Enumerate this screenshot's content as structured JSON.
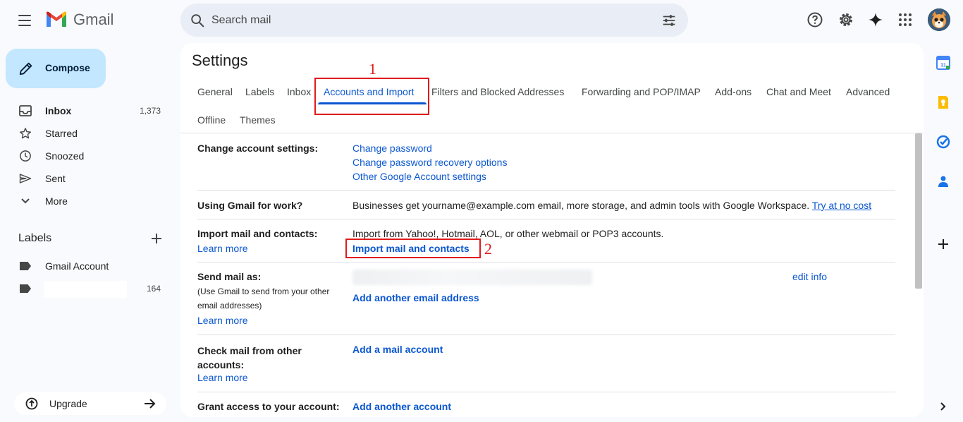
{
  "app": {
    "logo_text": "Gmail"
  },
  "search": {
    "placeholder": "Search mail"
  },
  "sidebar": {
    "compose_label": "Compose",
    "items": [
      {
        "label": "Inbox",
        "count": "1,373",
        "icon": "inbox-icon"
      },
      {
        "label": "Starred",
        "count": "",
        "icon": "star-icon"
      },
      {
        "label": "Snoozed",
        "count": "",
        "icon": "clock-icon"
      },
      {
        "label": "Sent",
        "count": "",
        "icon": "send-icon"
      },
      {
        "label": "More",
        "count": "",
        "icon": "chevron-down-icon"
      }
    ],
    "labels_heading": "Labels",
    "labels": [
      {
        "label": "Gmail Account",
        "count": ""
      },
      {
        "label": "",
        "count": "164"
      }
    ],
    "upgrade_label": "Upgrade"
  },
  "settings": {
    "title": "Settings",
    "tabs": [
      "General",
      "Labels",
      "Inbox",
      "Accounts and Import",
      "Filters and Blocked Addresses",
      "Forwarding and POP/IMAP",
      "Add-ons",
      "Chat and Meet",
      "Advanced",
      "Offline",
      "Themes"
    ],
    "active_tab": "Accounts and Import",
    "rows": {
      "change_account": {
        "label": "Change account settings:",
        "links": [
          "Change password",
          "Change password recovery options",
          "Other Google Account settings"
        ]
      },
      "work": {
        "label": "Using Gmail for work?",
        "text": "Businesses get yourname@example.com email, more storage, and admin tools with Google Workspace.",
        "link": "Try at no cost"
      },
      "import": {
        "label": "Import mail and contacts:",
        "learn_more": "Learn more",
        "text": "Import from Yahoo!, Hotmail, AOL, or other webmail or POP3 accounts.",
        "action": "Import mail and contacts"
      },
      "send_as": {
        "label": "Send mail as:",
        "note": "(Use Gmail to send from your other email addresses)",
        "learn_more": "Learn more",
        "edit": "edit info",
        "action": "Add another email address"
      },
      "check_mail": {
        "label": "Check mail from other accounts:",
        "learn_more": "Learn more",
        "action": "Add a mail account"
      },
      "grant": {
        "label": "Grant access to your account:",
        "action": "Add another account"
      }
    }
  },
  "annotations": {
    "step1": "1",
    "step2": "2"
  },
  "colors": {
    "accent": "#0b57d0",
    "compose_bg": "#c2e7ff",
    "annotation": "#e01b1b"
  }
}
